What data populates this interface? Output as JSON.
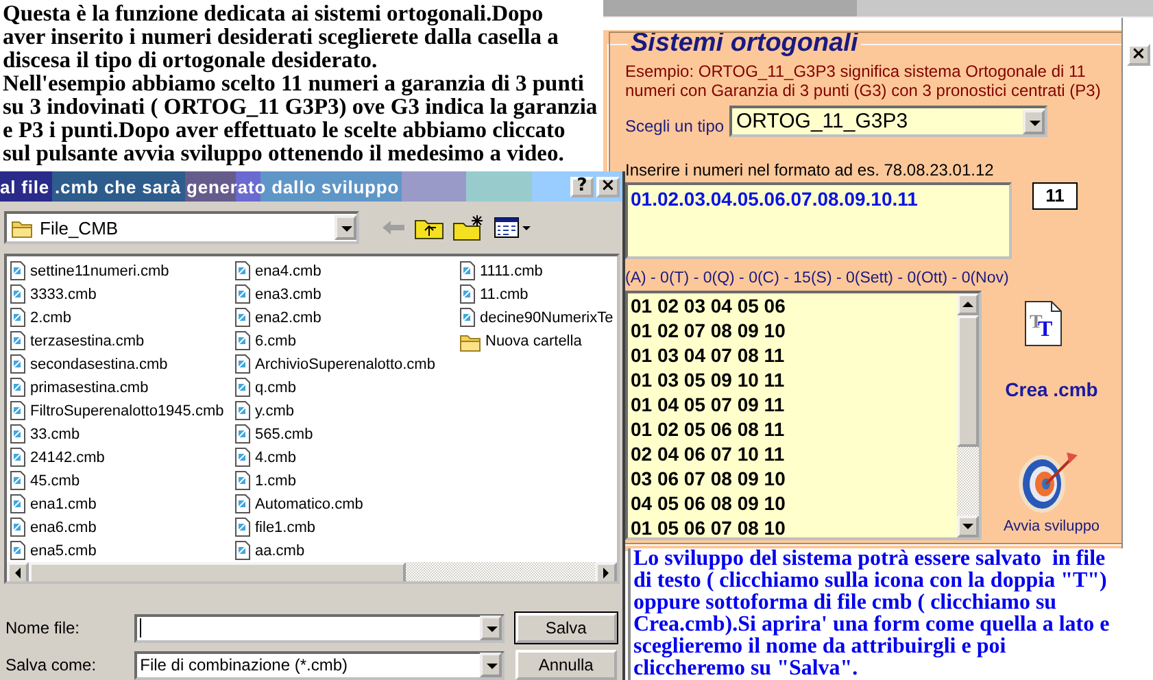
{
  "intro_text": "Questa è la funzione dedicata ai sistemi ortogonali.Dopo\naver inserito i numeri desiderati sceglierete dalla casella a\ndiscesa il tipo di ortogonale desiderato.\nNell'esempio abbiamo scelto 11 numeri a garanzia di 3 punti\nsu 3 indovinati ( ORTOG_11 G3P3) ove G3 indica la garanzia\ne P3 i punti.Dopo aver effettuato le scelte abbiamo cliccato\nsul pulsante avvia sviluppo ottenendo il medesimo a video.",
  "form": {
    "title": "Sistemi ortogonali",
    "example": "Esempio: ORTOG_11_G3P3 significa sistema Ortogonale di 11 numeri con Garanzia di 3 punti (G3) con 3 pronostici centrati (P3)",
    "type_label": "Scegli un tipo",
    "type_value": "ORTOG_11_G3P3",
    "numbers_label": "Inserire i numeri nel formato ad es. 78.08.23.01.12",
    "numbers_value": "01.02.03.04.05.06.07.08.09.10.11",
    "count": "11",
    "summary": "(A) - 0(T) - 0(Q) - 0(C) - 15(S) - 0(Sett) - 0(Ott) - 0(Nov)",
    "combinations": [
      "01 02 03 04 05 06",
      "01 02 07 08 09 10",
      "01 03 04 07 08 11",
      "01 03 05 09 10 11",
      "01 04 05 07 09 11",
      "01 02 05 06 08 11",
      "02 04 06 07 10 11",
      "03 06 07 08 09 10",
      "04 05 06 08 09 10",
      "01 05 06 07 08 10"
    ],
    "text_icon_letters": [
      "T",
      "T"
    ],
    "create_label": "Crea .cmb",
    "develop_label": "Avvia sviluppo",
    "close": "×"
  },
  "dialog": {
    "title": "al file .cmb che sarà generato dallo sviluppo",
    "title_buttons": [
      "?",
      "×"
    ],
    "folder": "File_CMB",
    "files": [
      {
        "name": "settine11numeri.cmb",
        "kind": "file"
      },
      {
        "name": "3333.cmb",
        "kind": "file"
      },
      {
        "name": "2.cmb",
        "kind": "file"
      },
      {
        "name": "terzasestina.cmb",
        "kind": "file"
      },
      {
        "name": "secondasestina.cmb",
        "kind": "file"
      },
      {
        "name": "primasestina.cmb",
        "kind": "file"
      },
      {
        "name": "FiltroSuperenalotto1945.cmb",
        "kind": "file"
      },
      {
        "name": "33.cmb",
        "kind": "file"
      },
      {
        "name": "24142.cmb",
        "kind": "file"
      },
      {
        "name": "45.cmb",
        "kind": "file"
      },
      {
        "name": "ena1.cmb",
        "kind": "file"
      },
      {
        "name": "ena6.cmb",
        "kind": "file"
      },
      {
        "name": "ena5.cmb",
        "kind": "file"
      },
      {
        "name": "ena4.cmb",
        "kind": "file"
      },
      {
        "name": "ena3.cmb",
        "kind": "file"
      },
      {
        "name": "ena2.cmb",
        "kind": "file"
      },
      {
        "name": "6.cmb",
        "kind": "file"
      },
      {
        "name": "ArchivioSuperenalotto.cmb",
        "kind": "file"
      },
      {
        "name": "q.cmb",
        "kind": "file"
      },
      {
        "name": "y.cmb",
        "kind": "file"
      },
      {
        "name": "565.cmb",
        "kind": "file"
      },
      {
        "name": "4.cmb",
        "kind": "file"
      },
      {
        "name": "1.cmb",
        "kind": "file"
      },
      {
        "name": "Automatico.cmb",
        "kind": "file"
      },
      {
        "name": "file1.cmb",
        "kind": "file"
      },
      {
        "name": "aa.cmb",
        "kind": "file"
      },
      {
        "name": "1111.cmb",
        "kind": "file"
      },
      {
        "name": "11.cmb",
        "kind": "file"
      },
      {
        "name": "decine90NumerixTe",
        "kind": "file"
      },
      {
        "name": "Nuova cartella",
        "kind": "folder"
      }
    ],
    "file_name_label": "Nome file:",
    "save_as_label": "Salva come:",
    "save_as_value": "File di combinazione (*.cmb)",
    "buttons": [
      "Salva",
      "Annulla"
    ]
  },
  "note_text": "Lo sviluppo del sistema potrà essere salvato  in file\ndi testo ( clicchiamo sulla icona con la doppia \"T\")\noppure sottoforma di file cmb ( clicchiamo su\nCrea.cmb).Si aprira' una form come quella a lato e\nsceglieremo il nome da attribuirgli e poi\ncliccheremo su \"Salva\"."
}
